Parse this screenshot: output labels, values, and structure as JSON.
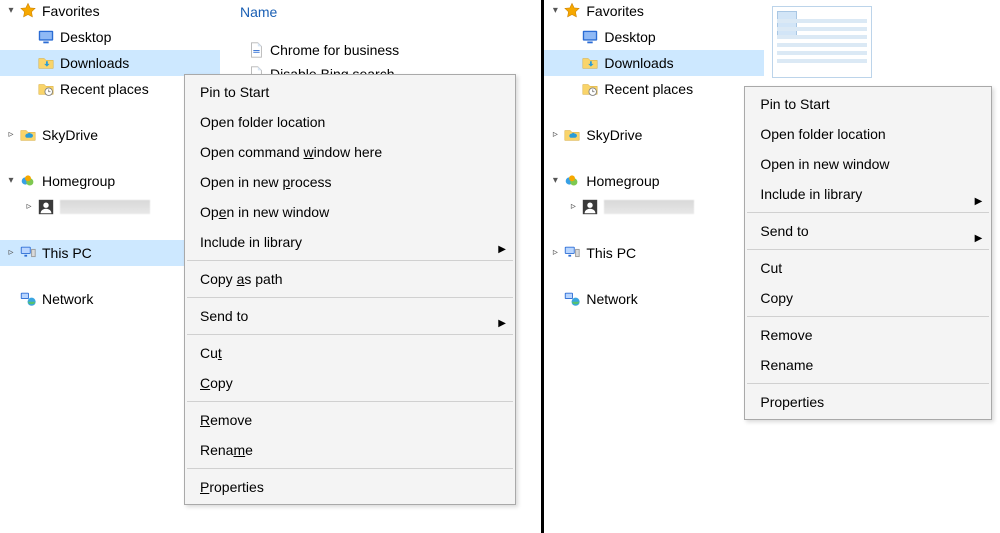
{
  "sidebar": {
    "favorites": "Favorites",
    "desktop": "Desktop",
    "downloads": "Downloads",
    "recent_places": "Recent places",
    "skydrive": "SkyDrive",
    "homegroup": "Homegroup",
    "this_pc": "This PC",
    "network": "Network"
  },
  "content": {
    "header_name": "Name",
    "item_chrome": "Chrome for business",
    "item_bing": "Disable Bing search"
  },
  "menu_left": {
    "pin_to_start": "Pin to Start",
    "open_folder_loc": "Open folder location",
    "open_cmd_pre": "Open command ",
    "open_cmd_accel": "w",
    "open_cmd_post": "indow here",
    "open_new_proc_pre": "Open in new ",
    "open_new_proc_accel": "p",
    "open_new_proc_post": "rocess",
    "open_new_window_pre": "Op",
    "open_new_window_accel": "e",
    "open_new_window_post": "n in new window",
    "include_in_library": "Include in library",
    "copy_as_path_pre": "Copy ",
    "copy_as_path_accel": "a",
    "copy_as_path_post": "s path",
    "send_to": "Send to",
    "cut_pre": "Cu",
    "cut_accel": "t",
    "copy_accel": "C",
    "copy_post": "opy",
    "remove_accel": "R",
    "remove_post": "emove",
    "rename_pre": "Rena",
    "rename_accel": "m",
    "rename_post": "e",
    "properties_accel": "P",
    "properties_post": "roperties"
  },
  "menu_right": {
    "pin_to_start": "Pin to Start",
    "open_folder_loc": "Open folder location",
    "open_new_window": "Open in new window",
    "include_in_library": "Include in library",
    "send_to": "Send to",
    "cut": "Cut",
    "copy": "Copy",
    "remove": "Remove",
    "rename": "Rename",
    "properties": "Properties"
  }
}
